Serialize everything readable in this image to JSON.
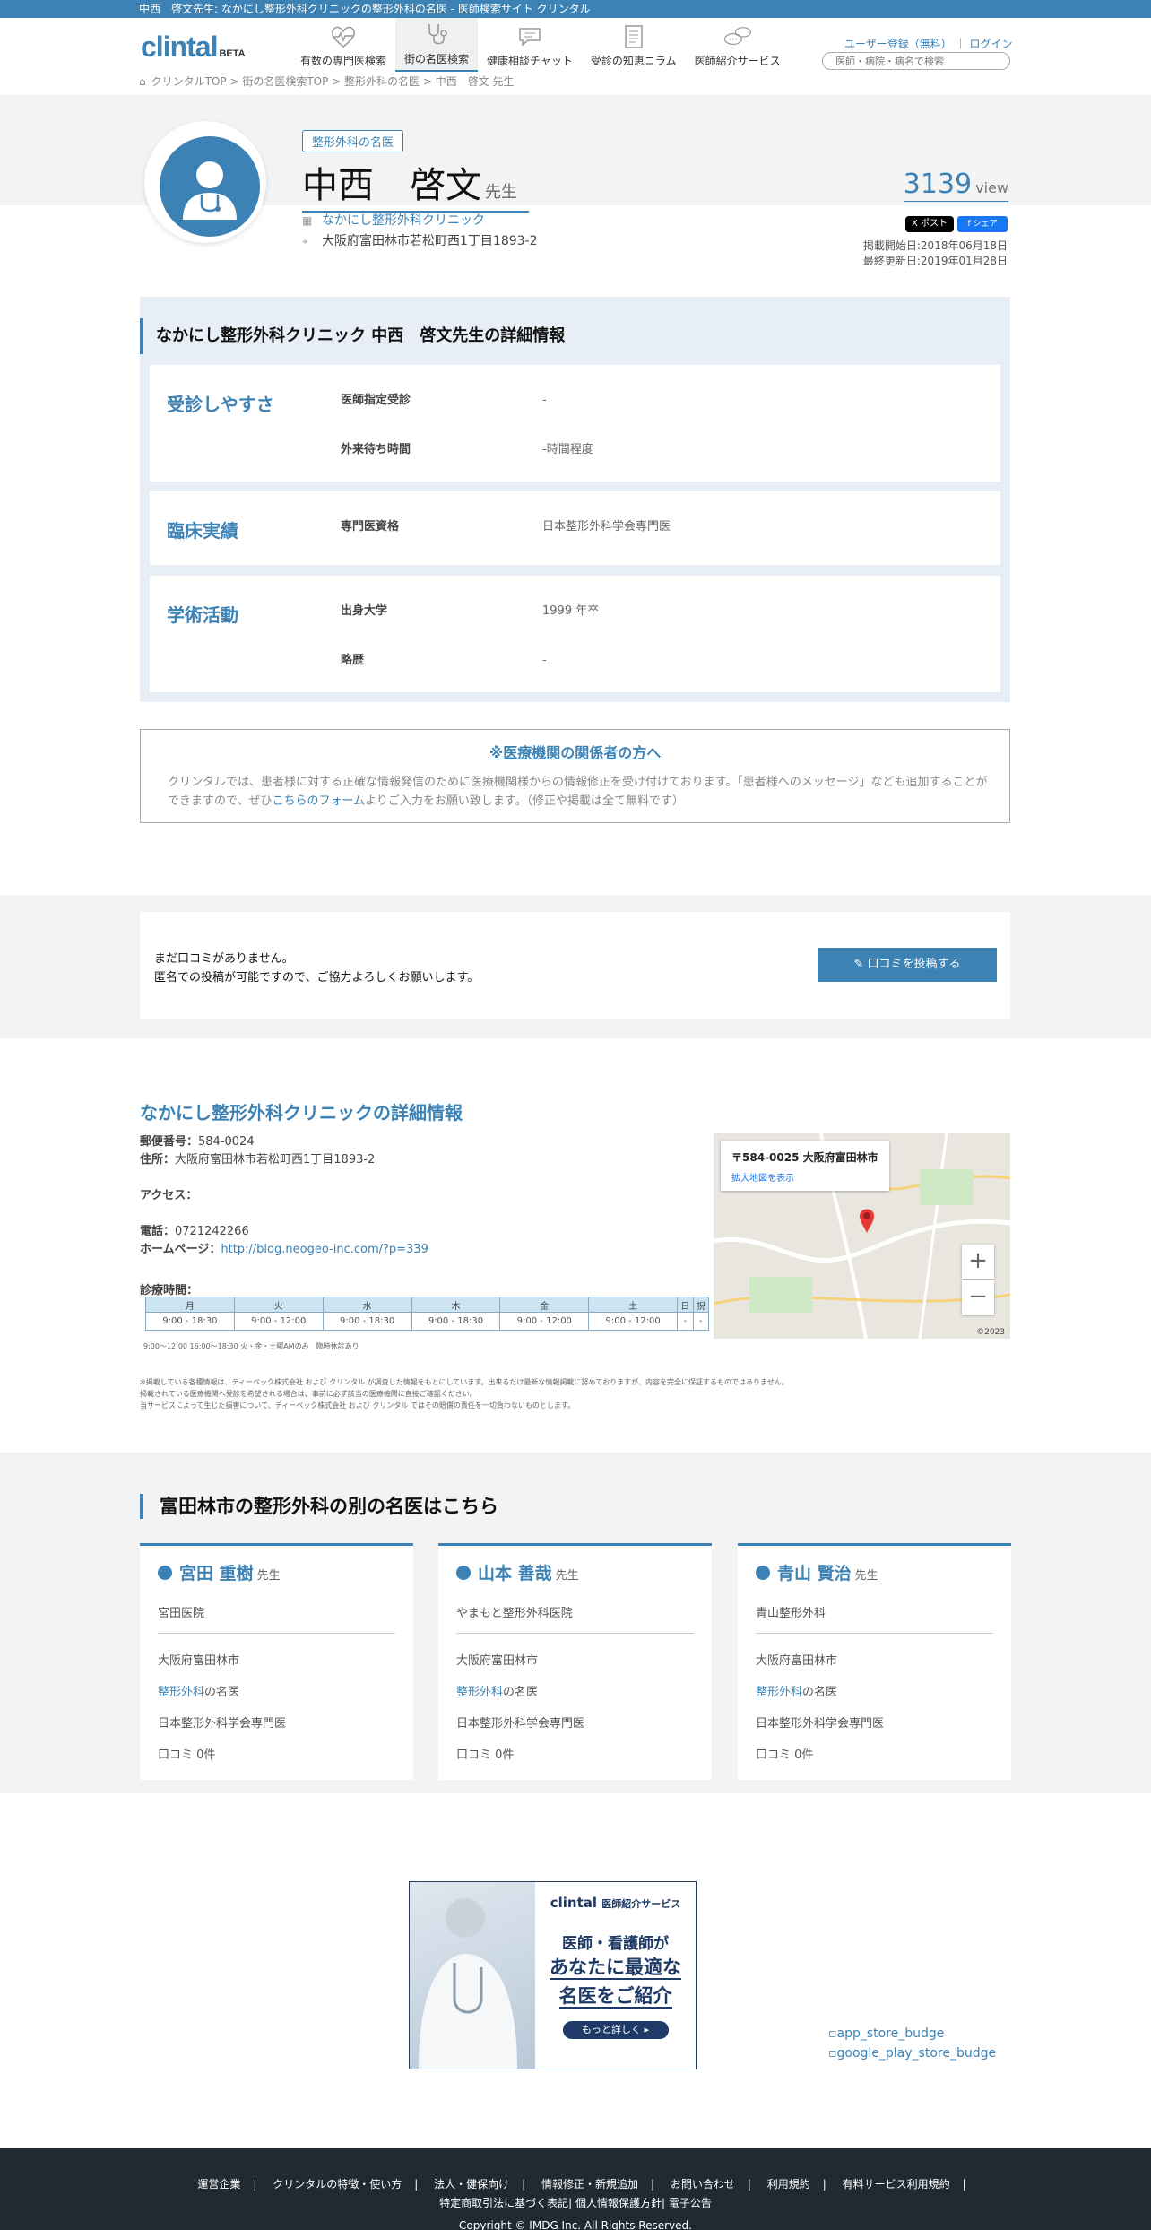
{
  "page_title": "中西　啓文先生: なかにし整形外科クリニックの整形外科の名医 - 医師検索サイト クリンタル",
  "brand": {
    "logo": "clintal",
    "beta": "BETA"
  },
  "nav": [
    {
      "label": "有数の専門医検索",
      "icon": "heartbeat-icon"
    },
    {
      "label": "街の名医検索",
      "icon": "stethoscope-icon"
    },
    {
      "label": "健康相談チャット",
      "icon": "chat-bubble-icon"
    },
    {
      "label": "受診の知恵コラム",
      "icon": "document-icon"
    },
    {
      "label": "医師紹介サービス",
      "icon": "chat-bubbles-icon"
    }
  ],
  "header_links": {
    "register": "ユーザー登録（無料）",
    "separator": "｜",
    "login": "ログイン"
  },
  "search": {
    "placeholder": "医師・病院・病名で検索"
  },
  "breadcrumb": "クリンタルTOP > 街の名医検索TOP > 整形外科の名医 > 中西　啓文 先生",
  "doctor": {
    "specialty_tag": "整形外科の名医",
    "name": "中西　啓文",
    "honorific": "先生",
    "clinic": "なかにし整形外科クリニック",
    "address": "大阪府富田林市若松町西1丁目1893-2",
    "views": "3139",
    "views_unit": "view",
    "share_x": "X ポスト",
    "share_fb": "f シェア",
    "published": "掲載開始日:2018年06月18日",
    "updated": "最終更新日:2019年01月28日"
  },
  "detail": {
    "title": "なかにし整形外科クリニック 中西　啓文先生の詳細情報",
    "sections": [
      {
        "title": "受診しやすさ",
        "rows": [
          {
            "k": "医師指定受診",
            "v": "-"
          },
          {
            "k": "外来待ち時間",
            "v": "-時間程度"
          }
        ]
      },
      {
        "title": "臨床実績",
        "rows": [
          {
            "k": "専門医資格",
            "v": "日本整形外科学会専門医"
          }
        ]
      },
      {
        "title": "学術活動",
        "rows": [
          {
            "k": "出身大学",
            "v": "1999 年卒"
          },
          {
            "k": "略歴",
            "v": "-"
          }
        ]
      }
    ]
  },
  "notice": {
    "title": "※医療機関の関係者の方へ",
    "body_1": "クリンタルでは、患者様に対する正確な情報発信のために医療機関様からの情報修正を受け付けております。「患者様へのメッセージ」なども追加することができますので、ぜひ",
    "link": "こちらのフォーム",
    "body_2": "よりご入力をお願い致します。（修正や掲載は全て無料です）"
  },
  "reviews": {
    "line1": "まだ口コミがありません。",
    "line2": "匿名での投稿が可能ですので、ご協力よろしくお願いします。",
    "button": "口コミを投稿する"
  },
  "clinic_info": {
    "title": "なかにし整形外科クリニックの詳細情報",
    "postal_label": "郵便番号：",
    "postal": "584-0024",
    "address_label": "住所：",
    "address": "大阪府富田林市若松町西1丁目1893-2",
    "access_label": "アクセス：",
    "phone_label": "電話：",
    "phone": "0721242266",
    "homepage_label": "ホームページ：",
    "homepage": "http://blog.neogeo-inc.com/?p=339",
    "hours_label": "診療時間：",
    "hours_head": [
      "月",
      "火",
      "水",
      "木",
      "金",
      "土",
      "日",
      "祝"
    ],
    "hours_row": [
      "9:00 - 18:30",
      "9:00 - 12:00",
      "9:00 - 18:30",
      "9:00 - 18:30",
      "9:00 - 12:00",
      "9:00 - 12:00",
      "-",
      "-"
    ],
    "hours_note": "9:00〜12:00 16:00〜18:30 火・金・土曜AMのみ　臨時休診あり",
    "map_title": "〒584-0025 大阪府富田林市…",
    "map_link": "拡大地図を表示",
    "map_attrib": "©2023"
  },
  "disclaimer": [
    "※掲載している各種情報は、ティーペック株式会社 および クリンタル が調査した情報をもとにしています。出来るだけ最新な情報掲載に努めておりますが、内容を完全に保証するものではありません。",
    "掲載されている医療機関へ受診を希望される場合は、事前に必ず該当の医療機関に直接ご確認ください。",
    "当サービスによって生じた損害について、ティーペック株式会社 および クリンタル ではその賠償の責任を一切負わないものとします。"
  ],
  "others": {
    "title": "富田林市の整形外科の別の名医はこちら",
    "honorific": "先生",
    "doctors": [
      {
        "name": "宮田 重樹",
        "clinic": "宮田医院",
        "city": "大阪府富田林市",
        "spec_link": "整形外科",
        "spec_suffix": "の名医",
        "cert": "日本整形外科学会専門医",
        "reviews": "口コミ 0件"
      },
      {
        "name": "山本 善哉",
        "clinic": "やまもと整形外科医院",
        "city": "大阪府富田林市",
        "spec_link": "整形外科",
        "spec_suffix": "の名医",
        "cert": "日本整形外科学会専門医",
        "reviews": "口コミ 0件"
      },
      {
        "name": "青山 賢治",
        "clinic": "青山整形外科",
        "city": "大阪府富田林市",
        "spec_link": "整形外科",
        "spec_suffix": "の名医",
        "cert": "日本整形外科学会専門医",
        "reviews": "口コミ 0件"
      }
    ]
  },
  "banner": {
    "logo": "clintal",
    "logo_sub": "医師紹介サービス",
    "l1": "医師・看護師が",
    "l2": "あなたに最適な",
    "l3": "名医をご紹介",
    "button": "もっと詳しく ▸"
  },
  "stores": {
    "app_store": "app_store_budge",
    "google_play": "google_play_store_budge"
  },
  "footer": {
    "links": [
      "運営企業",
      "クリンタルの特徴・使い方",
      "法人・健保向け",
      "情報修正・新規追加",
      "お問い合わせ",
      "利用規約",
      "有料サービス利用規約"
    ],
    "links2": [
      "特定商取引法に基づく表記",
      "個人情報保護方針",
      "電子公告"
    ],
    "copyright": "Copyright ©  IMDG Inc. All Rights Reserved."
  }
}
